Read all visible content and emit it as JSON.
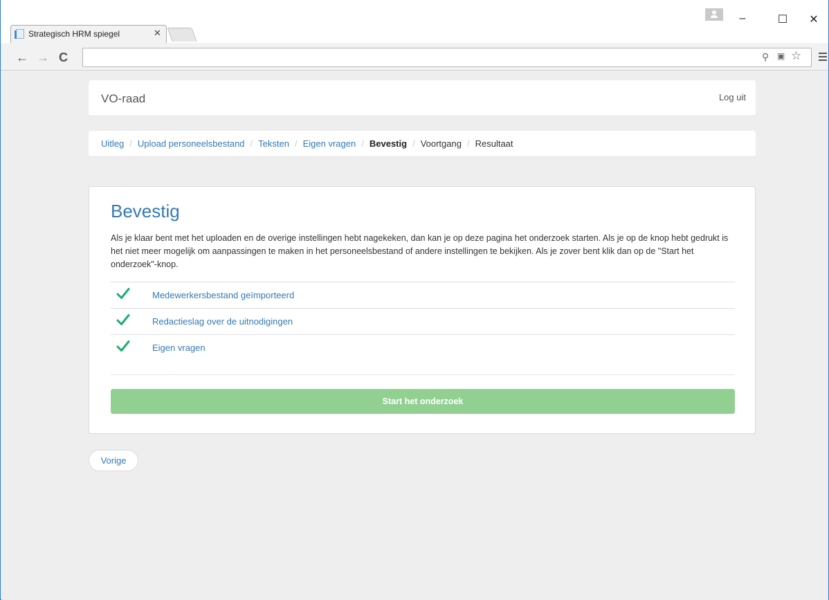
{
  "browser": {
    "tab_title": "Strategisch HRM spiegel",
    "tab_close": "✕",
    "url": "",
    "controls": {
      "minimize": "–",
      "maximize": "☐",
      "close": "✕"
    }
  },
  "header": {
    "brand": "VO-raad",
    "logout": "Log uit"
  },
  "breadcrumb": [
    {
      "label": "Uitleg",
      "state": "link"
    },
    {
      "label": "Upload personeelsbestand",
      "state": "link"
    },
    {
      "label": "Teksten",
      "state": "link"
    },
    {
      "label": "Eigen vragen",
      "state": "link"
    },
    {
      "label": "Bevestig",
      "state": "active"
    },
    {
      "label": "Voortgang",
      "state": "plain"
    },
    {
      "label": "Resultaat",
      "state": "plain"
    }
  ],
  "breadcrumb_separator": "/",
  "panel": {
    "title": "Bevestig",
    "intro": "Als je klaar bent met het uploaden en de overige instellingen hebt nagekeken, dan kan je op deze pagina het onderzoek starten. Als je op de knop hebt gedrukt is het niet meer mogelijk om aanpassingen te maken in het personeelsbestand of andere instellingen te bekijken. Als je zover bent klik dan op de \"Start het onderzoek\"-knop.",
    "checklist": [
      {
        "label": "Medewerkersbestand geïmporteerd",
        "icon": "check-icon"
      },
      {
        "label": "Redactieslag over de uitnodigingen",
        "icon": "check-icon"
      },
      {
        "label": "Eigen vragen",
        "icon": "check-icon"
      }
    ],
    "start_button": "Start het onderzoek"
  },
  "prev_button": "Vorige",
  "colors": {
    "link": "#337ab7",
    "check": "#1aae6f",
    "start_button": "#92d092",
    "page_background": "#eeeeee"
  }
}
